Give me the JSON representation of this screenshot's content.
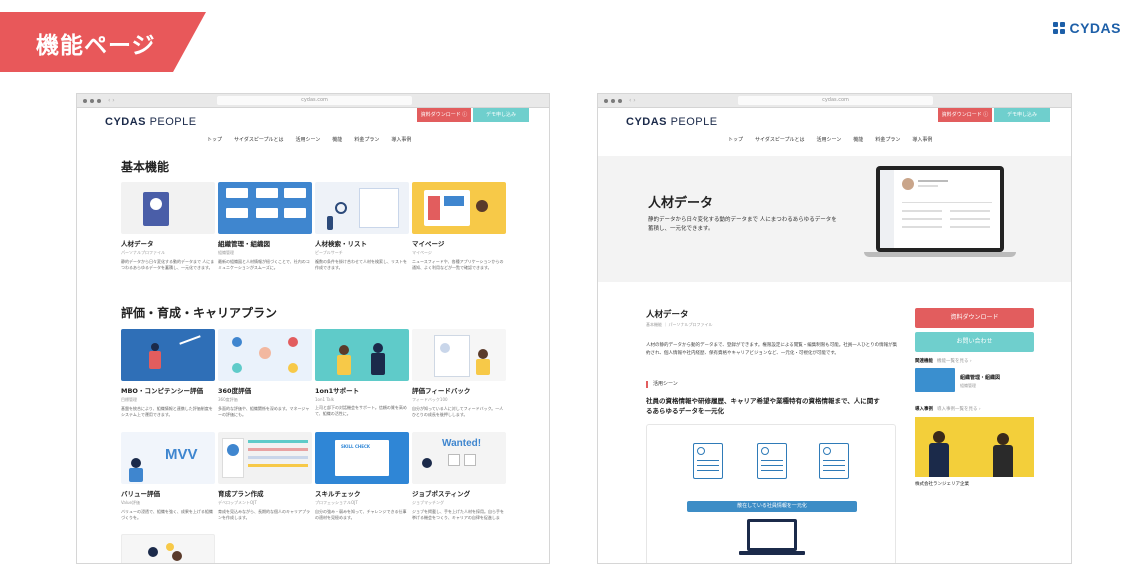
{
  "slide": {
    "title": "機能ページ",
    "brand": "CYDAS"
  },
  "browser": {
    "url": "cydas.com",
    "nav_arrows": "‹ ›"
  },
  "site": {
    "logo_bold": "CYDAS",
    "logo_light": " PEOPLE",
    "download_btn": "資料ダウンロード ⓘ",
    "demo_btn": "デモ申し込み",
    "nav": [
      "トップ",
      "サイダスピープルとは",
      "活用シーン",
      "機能",
      "料金プラン",
      "導入事例"
    ]
  },
  "left": {
    "basic_title": "基本機能",
    "basic_cards": [
      {
        "name": "人材データ",
        "sub": "パーソナルプロファイル",
        "desc": "静的データから日々変化する動的データまで 人にまつわるあらゆるデータを蓄積し、一元化できます。",
        "color": "#f2f2f2"
      },
      {
        "name": "組織管理・組織図",
        "sub": "組織管理",
        "desc": "最新の組織図と人材情報が紐づくことで、社内のコミュニケーションがスムーズに。",
        "color": "#3f86cf"
      },
      {
        "name": "人材検索・リスト",
        "sub": "ピープルサーチ",
        "desc": "複数の条件を掛け合わせて人材を検索し、リストを作成できます。",
        "color": "#eef2f8"
      },
      {
        "name": "マイページ",
        "sub": "マイページ",
        "desc": "ニュースフィードや、各種アプリケーションからの通知、よく利用などが一覧で確認できます。",
        "color": "#f7c948"
      }
    ],
    "eval_title": "評価・育成・キャリアプラン",
    "eval_cards": [
      {
        "name": "MBO・コンピテンシー評価",
        "sub": "目標管理",
        "desc": "基盤を統合により、組織情報と連携した評価制度をシステム上で運用できます。",
        "color": "#2f6fb7"
      },
      {
        "name": "360度評価",
        "sub": "360度評価",
        "desc": "多面的な評価や、組織関係を深めます。マネージャーの評価にも。",
        "color": "#eaf2fb"
      },
      {
        "name": "1on1サポート",
        "sub": "1on1 Talk",
        "desc": "上司と部下の対話機会をサポート。信頼の質を高めて、組織の活性に。",
        "color": "#5fcbc9"
      },
      {
        "name": "評価フィードバック",
        "sub": "フィードバック100",
        "desc": "自分が知っている人に対してフィードバック。一人ひとりの成長を後押しします。",
        "color": "#f6f6f6"
      },
      {
        "name": "バリュー評価",
        "sub": "Value評価",
        "desc": "バリューの浸透で、組織を強く、成果を上げる組織づくりを。",
        "color": "#f1f5fb",
        "badge": "MVV"
      },
      {
        "name": "育成プラン作成",
        "sub": "デベロップメントOJT",
        "desc": "育成を見込みながら、長期的な個人のキャリアプランを作成します。",
        "color": "#f2f2f2"
      },
      {
        "name": "スキルチェック",
        "sub": "プロフェッショナルOJT",
        "desc": "自分の強み・弱みを知って、チャレンジできる仕事の適材を見極めます。",
        "color": "#2f86d6",
        "badge": "SKILL CHECK"
      },
      {
        "name": "ジョブポスティング",
        "sub": "ジョブマッチング",
        "desc": "ジョブを掲載し、手を上げた人材を採用。自ら手を挙げる機会をつくり、キャリアの自律を促進します。",
        "color": "#f4f4f4",
        "badge": "Wanted!"
      }
    ]
  },
  "right": {
    "hero_title": "人材データ",
    "hero_text": "静的データから日々変化する動的データまで 人にまつわるあらゆるデータを蓄積し、一元化できます。",
    "detail_title": "人材データ",
    "detail_sub": "基本機能 ｜ パーソナルプロファイル",
    "detail_body": "人材の静的データから動的データまで、登録ができます。権限設定による閲覧・編集制限も可能。社員一人ひとりの情報が集約され、個人情報や社内経歴、保有資格やキャリアビジョンなど、一元化・可視化が可能です。",
    "scene_label": "活用シーン",
    "scene_head": "社員の資格情報や研修履歴、キャリア希望や業種特有の資格情報まで、人に関するあらゆるデータを一元化",
    "illus_bar": "散在している社員情報を一元化",
    "download_btn": "資料ダウンロード",
    "contact_btn": "お問い合わせ",
    "related_label": "関連機能",
    "related_more": "機能一覧を見る ›",
    "related_name": "組織管理・組織図",
    "related_sub": "組織管理",
    "case_label": "導入事例",
    "case_more": "導入事例一覧を見る ›",
    "case_caption": "株式会社ランジェリア企業"
  }
}
